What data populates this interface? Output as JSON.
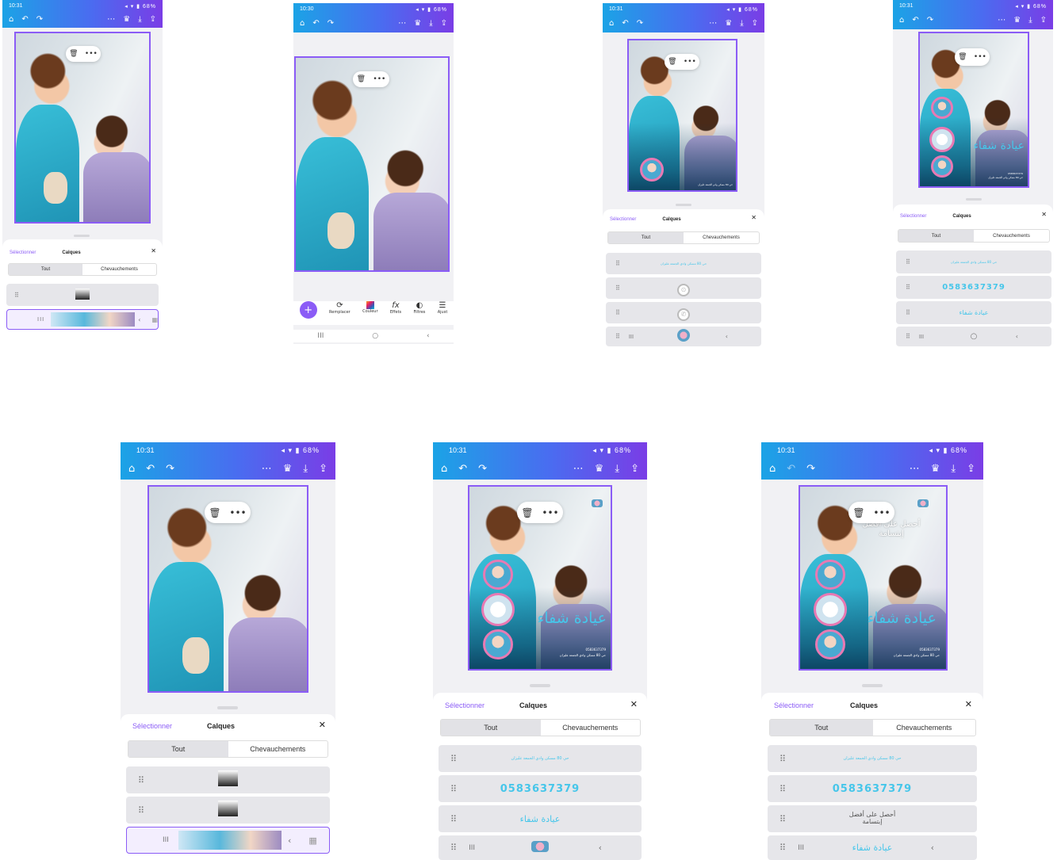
{
  "status": {
    "time_p1": "10:31",
    "time_p2": "10:30",
    "time_p3": "10:31",
    "time_p4": "10:31",
    "time_p5": "10:31",
    "time_p6": "10:31",
    "time_p7": "10:31",
    "battery": "68%"
  },
  "toolbar_icons": [
    "home-icon",
    "undo-icon",
    "redo-icon",
    "more-icon",
    "crown-icon",
    "download-icon",
    "share-icon"
  ],
  "selection_pill": {
    "delete_icon": "trash-icon",
    "more": "•••"
  },
  "design": {
    "clinic_name": "عيادة شفاء",
    "offer_line1": "أحصل على أفضل",
    "offer_line2": "إبتسامة",
    "phone": "0583637379",
    "address": "حي 80 مسكن وادي الجمعة غليزان"
  },
  "layers_panel": {
    "select_label": "Sélectionner",
    "title": "Calques",
    "tab_all": "Tout",
    "tab_overlaps": "Chevauchements",
    "close_icon": "close-icon"
  },
  "edit_toolbar": {
    "tools": [
      "Remplacer",
      "Couleur",
      "Effets",
      "Filtres",
      "Ajust"
    ]
  },
  "colors": {
    "accent": "#8b5cf6",
    "brand_gradient_start": "#1ba3e6",
    "brand_gradient_end": "#7a3de6",
    "clinic_text": "#46c6ea"
  }
}
